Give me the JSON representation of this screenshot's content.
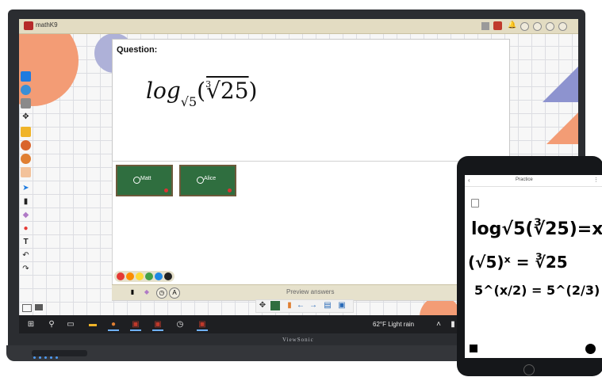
{
  "app": {
    "title": "mathK9"
  },
  "question": {
    "label": "Question:",
    "formula_log": "log",
    "formula_base": "√5",
    "formula_open": "(",
    "formula_index": "3",
    "formula_radical": "√25",
    "formula_close": ")"
  },
  "students": [
    {
      "name": "Matt"
    },
    {
      "name": "Alice"
    }
  ],
  "palette_colors": [
    "#e53935",
    "#fb8c00",
    "#fdd835",
    "#43a047",
    "#1e88e5",
    "#222222"
  ],
  "preview": {
    "label": "Preview answers"
  },
  "taskbar": {
    "weather": "62°F  Light rain"
  },
  "monitor": {
    "brand": "ViewSonic"
  },
  "tablet": {
    "title": "Practice",
    "line1": "log√5(∛25)=x",
    "line2": "(√5)ˣ = ∛25",
    "line3": "5^(x/2) = 5^(2/3)"
  },
  "colors": {
    "accent_orange": "#f39c75",
    "accent_purple": "#8d93cf",
    "card_green": "#2f6e3f",
    "toolbar_beige": "#e6e1cc"
  }
}
